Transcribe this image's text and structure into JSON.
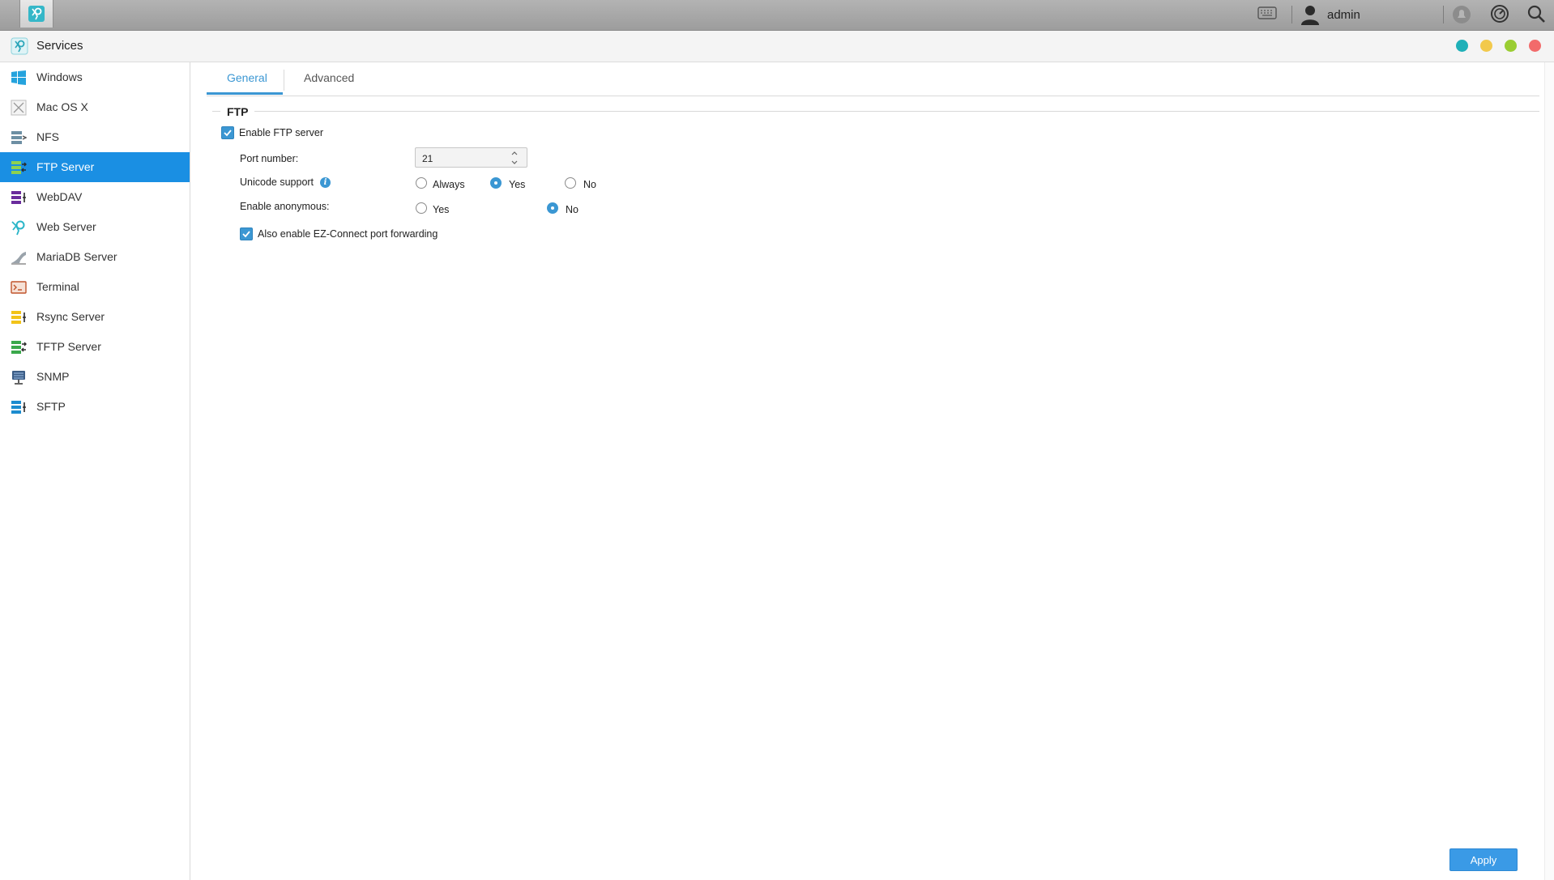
{
  "topbar": {
    "username": "admin",
    "icons": [
      "app-icon",
      "keyboard-icon",
      "user-icon",
      "notification-icon",
      "dashboard-icon",
      "search-icon"
    ]
  },
  "window": {
    "title": "Services",
    "controls": [
      "minimize-dot",
      "restore-dot",
      "maximize-dot",
      "close-dot"
    ],
    "control_colors": [
      "#1fb0b8",
      "#f2c94c",
      "#9acd32",
      "#f26b6b"
    ]
  },
  "sidebar": {
    "active_index": 3,
    "accent": "#1a8fe3",
    "items": [
      {
        "label": "Windows",
        "icon": "windows-icon"
      },
      {
        "label": "Mac OS X",
        "icon": "macos-icon"
      },
      {
        "label": "NFS",
        "icon": "nfs-icon"
      },
      {
        "label": "FTP Server",
        "icon": "ftp-server-icon"
      },
      {
        "label": "WebDAV",
        "icon": "webdav-icon"
      },
      {
        "label": "Web Server",
        "icon": "web-server-icon"
      },
      {
        "label": "MariaDB Server",
        "icon": "mariadb-icon"
      },
      {
        "label": "Terminal",
        "icon": "terminal-icon"
      },
      {
        "label": "Rsync Server",
        "icon": "rsync-icon"
      },
      {
        "label": "TFTP Server",
        "icon": "tftp-icon"
      },
      {
        "label": "SNMP",
        "icon": "snmp-icon"
      },
      {
        "label": "SFTP",
        "icon": "sftp-icon"
      }
    ]
  },
  "tabs": {
    "items": [
      {
        "label": "General",
        "active": true
      },
      {
        "label": "Advanced",
        "active": false
      }
    ]
  },
  "ftp": {
    "section_title": "FTP",
    "enable_label": "Enable FTP server",
    "enable_checked": true,
    "port_label": "Port number:",
    "port_value": "21",
    "unicode_label": "Unicode support",
    "unicode_options": [
      "Always",
      "Yes",
      "No"
    ],
    "unicode_selected": "Yes",
    "anonymous_label": "Enable anonymous:",
    "anonymous_options": [
      "Yes",
      "No"
    ],
    "anonymous_selected": "No",
    "ezconnect_label": "Also enable EZ-Connect port forwarding",
    "ezconnect_checked": true
  },
  "footer": {
    "apply_label": "Apply"
  }
}
